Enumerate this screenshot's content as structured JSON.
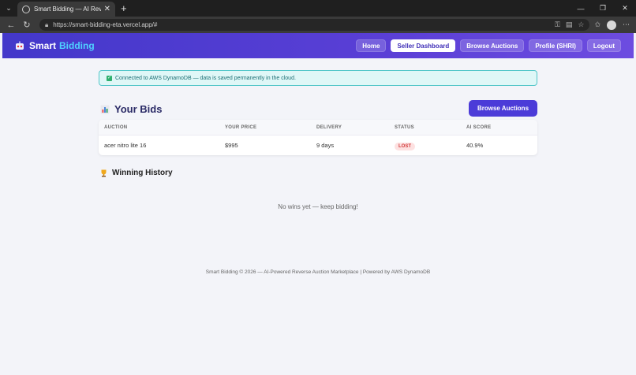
{
  "browser": {
    "tab_title": "Smart Bidding — AI Reverse Auctio",
    "url": "https://smart-bidding-eta.vercel.app/#"
  },
  "header": {
    "logo_part1": "Smart",
    "logo_part2": "Bidding",
    "nav": {
      "home": "Home",
      "seller_dashboard": "Seller Dashboard",
      "browse": "Browse Auctions",
      "profile": "Profile (SHRI)",
      "logout": "Logout"
    },
    "colors": {
      "bar_start": "#4338ca",
      "bar_end": "#6d4ce0",
      "logo_accent": "#4fd1ff"
    }
  },
  "alert": {
    "text": "Connected to AWS DynamoDB — data is saved permanently in the cloud."
  },
  "bids": {
    "title": "Your Bids",
    "browse_button": "Browse Auctions",
    "columns": [
      "AUCTION",
      "YOUR PRICE",
      "DELIVERY",
      "STATUS",
      "AI SCORE"
    ],
    "rows": [
      {
        "auction": "acer nitro lite 16",
        "price": "$995",
        "delivery": "9 days",
        "status": "LOST",
        "ai_score": "40.9%"
      }
    ]
  },
  "history": {
    "title": "Winning History",
    "empty": "No wins yet — keep bidding!"
  },
  "footer": {
    "text": "Smart Bidding © 2026 — AI-Powered Reverse Auction Marketplace | Powered by AWS DynamoDB"
  }
}
